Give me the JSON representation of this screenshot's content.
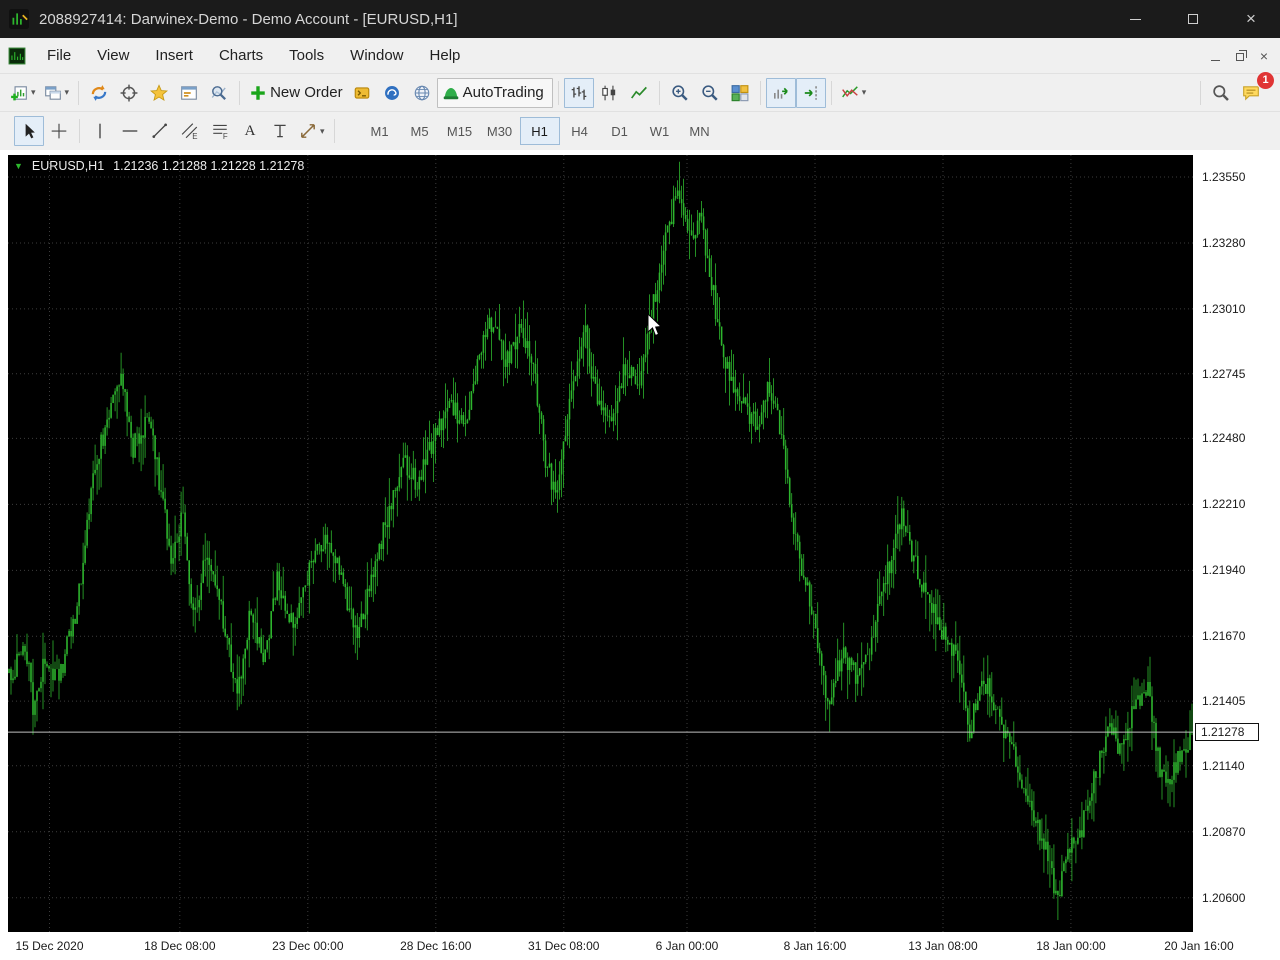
{
  "window": {
    "title": "2088927414: Darwinex-Demo - Demo Account - [EURUSD,H1]"
  },
  "menu": {
    "items": [
      "File",
      "View",
      "Insert",
      "Charts",
      "Tools",
      "Window",
      "Help"
    ]
  },
  "toolbar1": {
    "new_order": "New Order",
    "autotrading": "AutoTrading",
    "chat_badge": "1"
  },
  "timeframes": {
    "items": [
      "M1",
      "M5",
      "M15",
      "M30",
      "H1",
      "H4",
      "D1",
      "W1",
      "MN"
    ],
    "active": "H1"
  },
  "icons": {
    "dropdown_arrow": "▾",
    "collapse_arrow": "▼",
    "close_glyph": "×",
    "text_tool": "A"
  },
  "chart": {
    "symbol": "EURUSD,H1",
    "ohlc": "1.21236 1.21288 1.21228 1.21278"
  },
  "chart_data": {
    "type": "candlestick",
    "symbol": "EURUSD",
    "timeframe": "H1",
    "ohlc": {
      "open": "1.21236",
      "high": "1.21288",
      "low": "1.21228",
      "close": "1.21278"
    },
    "current_price": "1.21278",
    "background": "#000000",
    "grid_color": "#3d3d3d",
    "up_color": "#2db52d",
    "current_price_line_color": "#c0c0c0",
    "price_axis_ticks": [
      "1.23550",
      "1.23280",
      "1.23010",
      "1.22745",
      "1.22480",
      "1.22210",
      "1.21940",
      "1.21670",
      "1.21405",
      "1.21140",
      "1.20870",
      "1.20600"
    ],
    "time_axis_labels": [
      "15 Dec 2020",
      "18 Dec 08:00",
      "23 Dec 00:00",
      "28 Dec 16:00",
      "31 Dec 08:00",
      "6 Jan 00:00",
      "8 Jan 16:00",
      "13 Jan 08:00",
      "18 Jan 00:00",
      "20 Jan 16:00"
    ],
    "time_axis_fracs": [
      0.035,
      0.145,
      0.253,
      0.361,
      0.469,
      0.573,
      0.681,
      0.789,
      0.897,
      1.005
    ],
    "price_min": 1.2046,
    "price_max": 1.2364,
    "bar_count": 592,
    "price_path": [
      [
        0.002,
        1.2152
      ],
      [
        0.014,
        1.2163
      ],
      [
        0.021,
        1.2136
      ],
      [
        0.031,
        1.2159
      ],
      [
        0.042,
        1.2149
      ],
      [
        0.057,
        1.2178
      ],
      [
        0.073,
        1.2238
      ],
      [
        0.088,
        1.2262
      ],
      [
        0.095,
        1.2273
      ],
      [
        0.105,
        1.2244
      ],
      [
        0.118,
        1.2257
      ],
      [
        0.128,
        1.2228
      ],
      [
        0.138,
        1.2198
      ],
      [
        0.147,
        1.222
      ],
      [
        0.156,
        1.2172
      ],
      [
        0.166,
        1.22
      ],
      [
        0.179,
        1.2178
      ],
      [
        0.193,
        1.2142
      ],
      [
        0.204,
        1.2178
      ],
      [
        0.215,
        1.2156
      ],
      [
        0.227,
        1.219
      ],
      [
        0.24,
        1.2172
      ],
      [
        0.255,
        1.2196
      ],
      [
        0.27,
        1.2208
      ],
      [
        0.283,
        1.2186
      ],
      [
        0.295,
        1.2168
      ],
      [
        0.307,
        1.2192
      ],
      [
        0.321,
        1.2218
      ],
      [
        0.333,
        1.224
      ],
      [
        0.345,
        1.2229
      ],
      [
        0.358,
        1.2247
      ],
      [
        0.373,
        1.226
      ],
      [
        0.387,
        1.2255
      ],
      [
        0.398,
        1.2283
      ],
      [
        0.409,
        1.2297
      ],
      [
        0.42,
        1.2279
      ],
      [
        0.432,
        1.2291
      ],
      [
        0.443,
        1.228
      ],
      [
        0.454,
        1.2238
      ],
      [
        0.462,
        1.2226
      ],
      [
        0.474,
        1.2264
      ],
      [
        0.486,
        1.2294
      ],
      [
        0.498,
        1.226
      ],
      [
        0.509,
        1.2252
      ],
      [
        0.521,
        1.2278
      ],
      [
        0.533,
        1.2268
      ],
      [
        0.543,
        1.2298
      ],
      [
        0.555,
        1.233
      ],
      [
        0.565,
        1.2348
      ],
      [
        0.576,
        1.2329
      ],
      [
        0.585,
        1.2339
      ],
      [
        0.595,
        1.2308
      ],
      [
        0.606,
        1.2276
      ],
      [
        0.619,
        1.2266
      ],
      [
        0.631,
        1.2253
      ],
      [
        0.643,
        1.2271
      ],
      [
        0.654,
        1.2246
      ],
      [
        0.665,
        1.2206
      ],
      [
        0.678,
        1.218
      ],
      [
        0.692,
        1.2139
      ],
      [
        0.705,
        1.216
      ],
      [
        0.717,
        1.215
      ],
      [
        0.73,
        1.2167
      ],
      [
        0.743,
        1.2194
      ],
      [
        0.754,
        1.2217
      ],
      [
        0.764,
        1.2199
      ],
      [
        0.775,
        1.2184
      ],
      [
        0.787,
        1.2171
      ],
      [
        0.8,
        1.216
      ],
      [
        0.812,
        1.2129
      ],
      [
        0.824,
        1.215
      ],
      [
        0.837,
        1.2134
      ],
      [
        0.851,
        1.2116
      ],
      [
        0.863,
        1.2096
      ],
      [
        0.876,
        1.208
      ],
      [
        0.886,
        1.2061
      ],
      [
        0.897,
        1.2079
      ],
      [
        0.907,
        1.2089
      ],
      [
        0.918,
        1.2109
      ],
      [
        0.931,
        1.2131
      ],
      [
        0.941,
        1.2119
      ],
      [
        0.952,
        1.2141
      ],
      [
        0.963,
        1.2145
      ],
      [
        0.973,
        1.2111
      ],
      [
        0.983,
        1.2109
      ],
      [
        0.992,
        1.2121
      ],
      [
        1.0,
        1.21278
      ]
    ]
  }
}
